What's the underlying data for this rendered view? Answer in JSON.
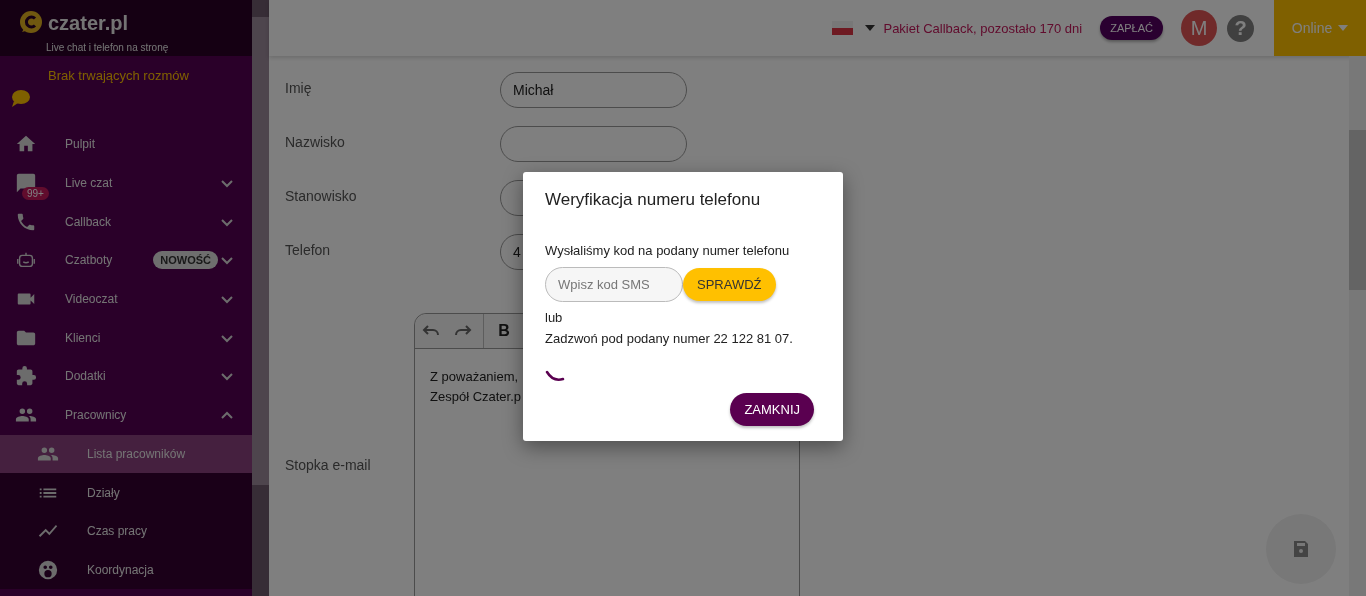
{
  "logo": {
    "name": "czater.pl",
    "tagline": "Live chat i telefon na stronę"
  },
  "sidebar": {
    "status": "Brak trwających rozmów",
    "items": [
      {
        "label": "Pulpit",
        "kind": "link"
      },
      {
        "label": "Live czat",
        "kind": "group",
        "expanded": false,
        "badge": "99+"
      },
      {
        "label": "Callback",
        "kind": "group",
        "expanded": false
      },
      {
        "label": "Czatboty",
        "kind": "group",
        "expanded": false,
        "tag": "NOWOŚĆ"
      },
      {
        "label": "Videoczat",
        "kind": "group",
        "expanded": false
      },
      {
        "label": "Klienci",
        "kind": "group",
        "expanded": false
      },
      {
        "label": "Dodatki",
        "kind": "group",
        "expanded": false
      },
      {
        "label": "Pracownicy",
        "kind": "group",
        "expanded": true,
        "children": [
          {
            "label": "Lista pracowników",
            "selected": true
          },
          {
            "label": "Działy",
            "selected": false
          },
          {
            "label": "Czas pracy",
            "selected": false
          },
          {
            "label": "Koordynacja",
            "selected": false
          }
        ]
      }
    ]
  },
  "topbar": {
    "package": "Pakiet Callback, pozostało 170 dni",
    "pay_button": "ZAPŁAĆ",
    "avatar": "M",
    "help": "?",
    "status": "Online"
  },
  "form": {
    "fields": [
      {
        "label": "Imię",
        "value": "Michał"
      },
      {
        "label": "Nazwisko"
      },
      {
        "label": "Stanowisko"
      },
      {
        "label": "Telefon",
        "value": "4"
      }
    ],
    "editor": {
      "label": "Stopka e-mail",
      "bold": "B",
      "lines": [
        "Z poważaniem,",
        "Zespół Czater.p"
      ]
    }
  },
  "modal": {
    "title": "Weryfikacja numeru telefonu",
    "message": "Wysłaliśmy kod na podany numer telefonu",
    "code_placeholder": "Wpisz kod SMS",
    "check_button": "SPRAWDŹ",
    "or": "lub",
    "call_text": "Zadzwoń pod podany numer 22 122 81 07.",
    "close_button": "ZAMKNIJ"
  }
}
